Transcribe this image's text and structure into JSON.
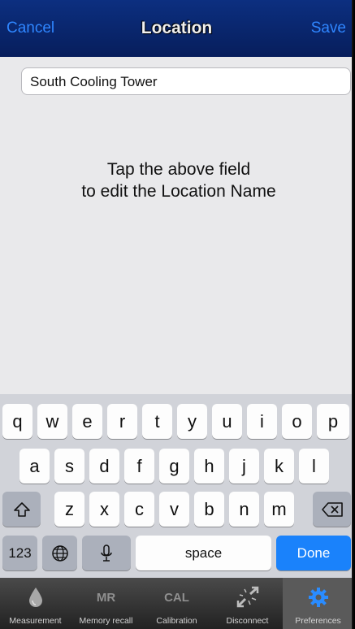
{
  "nav": {
    "cancel_label": "Cancel",
    "title": "Location",
    "save_label": "Save"
  },
  "location_field": {
    "value": "South Cooling Tower"
  },
  "hint": {
    "line1": "Tap the above field",
    "line2": "to edit the Location Name"
  },
  "keyboard": {
    "row1": [
      "q",
      "w",
      "e",
      "r",
      "t",
      "y",
      "u",
      "i",
      "o",
      "p"
    ],
    "row2": [
      "a",
      "s",
      "d",
      "f",
      "g",
      "h",
      "j",
      "k",
      "l"
    ],
    "row3": [
      "z",
      "x",
      "c",
      "v",
      "b",
      "n",
      "m"
    ],
    "numbers_label": "123",
    "space_label": "space",
    "done_label": "Done",
    "accent_color": "#1a82fb"
  },
  "tabs": [
    {
      "label": "Measurement",
      "icon": "drop-icon"
    },
    {
      "label": "Memory recall",
      "icon_text": "MR"
    },
    {
      "label": "Calibration",
      "icon_text": "CAL"
    },
    {
      "label": "Disconnect",
      "icon": "disconnect-icon"
    },
    {
      "label": "Preferences",
      "icon": "gear-icon",
      "active": true
    }
  ],
  "colors": {
    "nav_bg": "#0a2a78",
    "nav_button": "#2f86ff",
    "active_tab_icon": "#2a8cff"
  }
}
